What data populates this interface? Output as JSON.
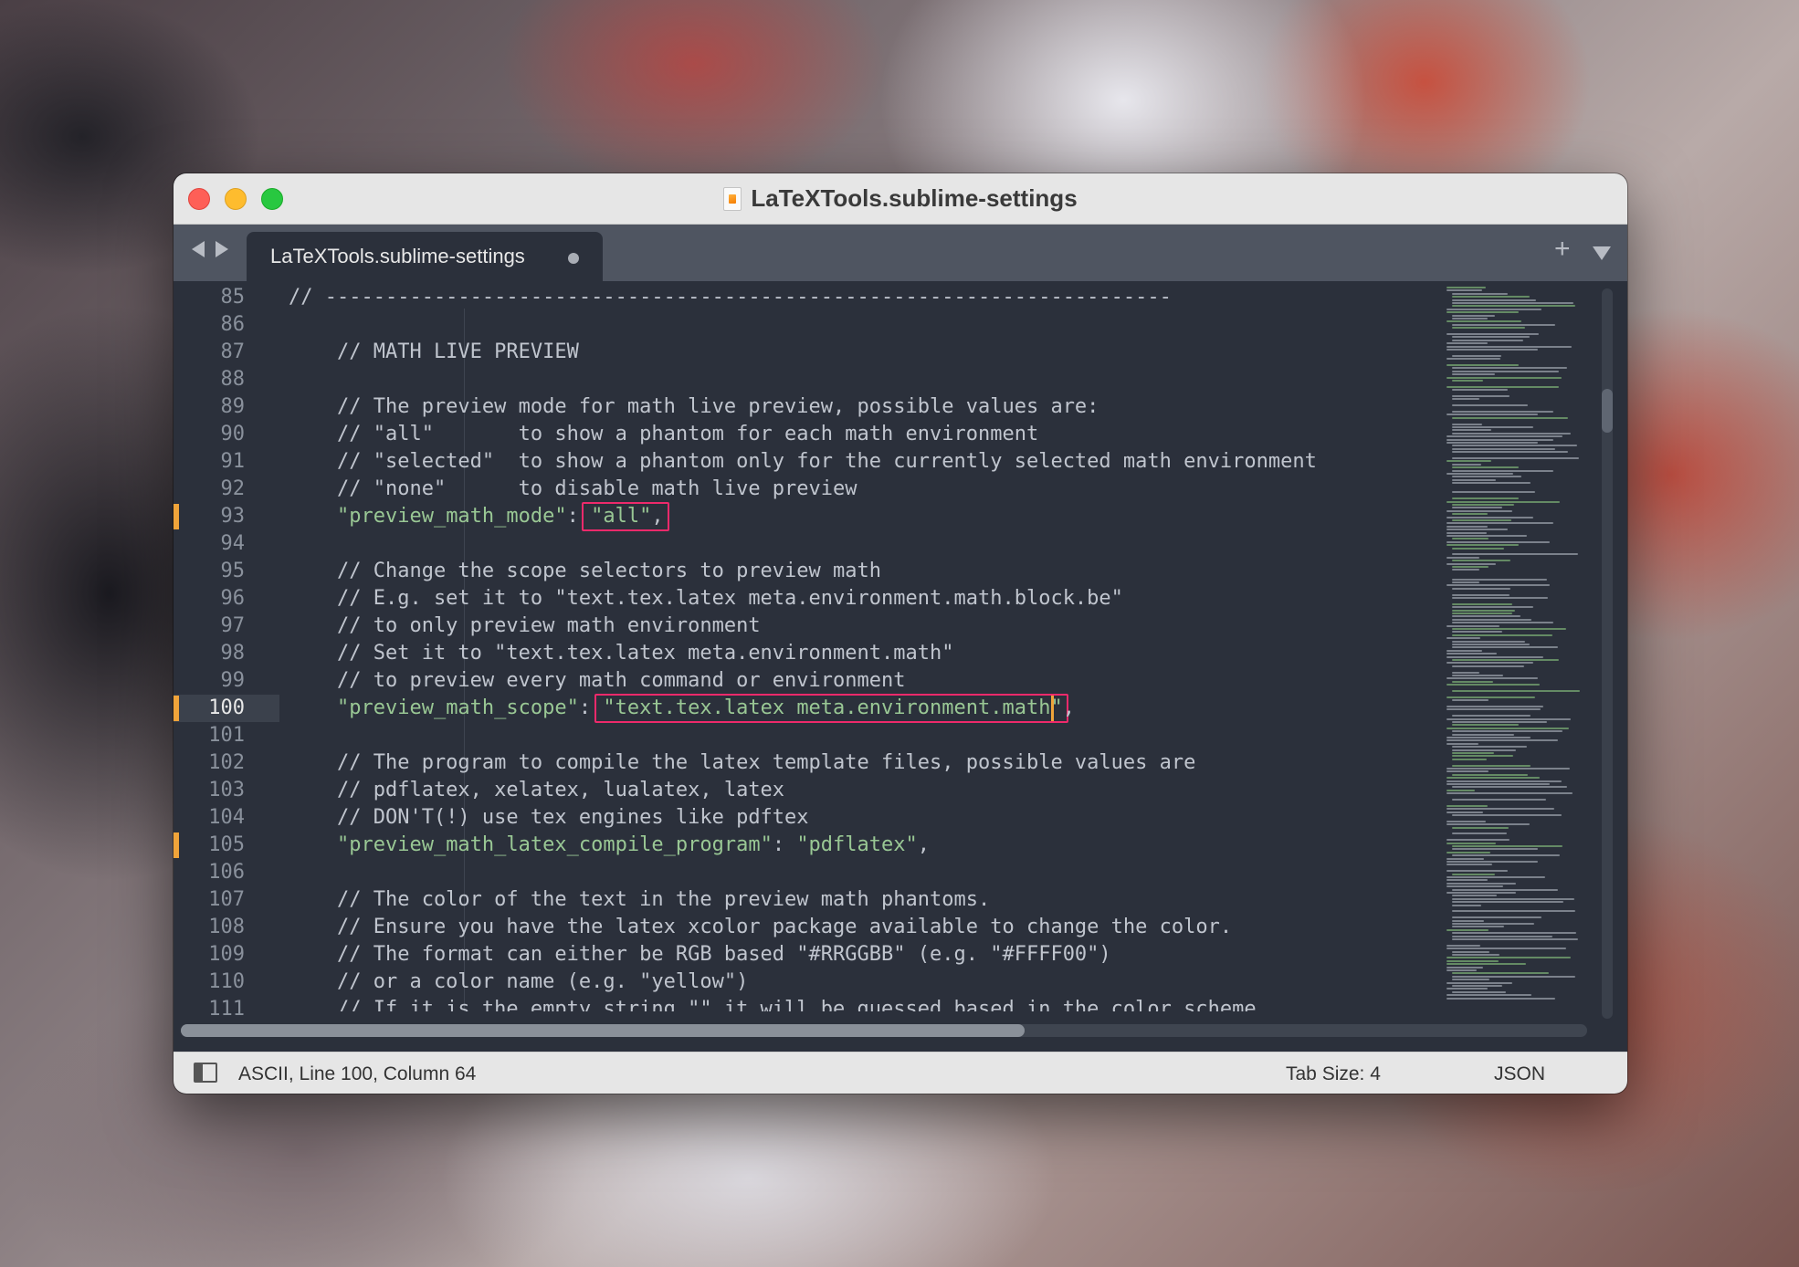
{
  "window": {
    "title": "LaTeXTools.sublime-settings"
  },
  "tabs": [
    {
      "label": "LaTeXTools.sublime-settings",
      "modified": true
    }
  ],
  "editor": {
    "current_line": 100,
    "lines": [
      {
        "n": "85",
        "text": "// ----------------------------------------------------------------------"
      },
      {
        "n": "86",
        "text": ""
      },
      {
        "n": "87",
        "text": "    // MATH LIVE PREVIEW"
      },
      {
        "n": "88",
        "text": ""
      },
      {
        "n": "89",
        "text": "    // The preview mode for math live preview, possible values are:"
      },
      {
        "n": "90",
        "text": "    // \"all\"       to show a phantom for each math environment"
      },
      {
        "n": "91",
        "text": "    // \"selected\"  to show a phantom only for the currently selected math environment"
      },
      {
        "n": "92",
        "text": "    // \"none\"      to disable math live preview"
      },
      {
        "n": "93",
        "key": "\"preview_math_mode\"",
        "sep": ": ",
        "value": "\"all\"",
        "tail": ","
      },
      {
        "n": "94",
        "text": ""
      },
      {
        "n": "95",
        "text": "    // Change the scope selectors to preview math"
      },
      {
        "n": "96",
        "text": "    // E.g. set it to \"text.tex.latex meta.environment.math.block.be\""
      },
      {
        "n": "97",
        "text": "    // to only preview math environment"
      },
      {
        "n": "98",
        "text": "    // Set it to \"text.tex.latex meta.environment.math\""
      },
      {
        "n": "99",
        "text": "    // to preview every math command or environment"
      },
      {
        "n": "100",
        "key": "\"preview_math_scope\"",
        "sep": ": ",
        "value": "\"text.tex.latex meta.environment.math\"",
        "tail": ","
      },
      {
        "n": "101",
        "text": ""
      },
      {
        "n": "102",
        "text": "    // The program to compile the latex template files, possible values are"
      },
      {
        "n": "103",
        "text": "    // pdflatex, xelatex, lualatex, latex"
      },
      {
        "n": "104",
        "text": "    // DON'T(!) use tex engines like pdftex"
      },
      {
        "n": "105",
        "key": "\"preview_math_latex_compile_program\"",
        "sep": ": ",
        "value": "\"pdflatex\"",
        "tail": ","
      },
      {
        "n": "106",
        "text": ""
      },
      {
        "n": "107",
        "text": "    // The color of the text in the preview math phantoms."
      },
      {
        "n": "108",
        "text": "    // Ensure you have the latex xcolor package available to change the color."
      },
      {
        "n": "109",
        "text": "    // The format can either be RGB based \"#RRGGBB\" (e.g. \"#FFFF00\")"
      },
      {
        "n": "110",
        "text": "    // or a color name (e.g. \"yellow\")"
      },
      {
        "n": "111",
        "text": "    // If it is the empty string \"\" it will be guessed based in the color scheme."
      }
    ]
  },
  "status_bar": {
    "position": "ASCII, Line 100, Column 64",
    "tab_size": "Tab Size: 4",
    "syntax": "JSON"
  },
  "colors": {
    "editor_bg": "#2b303b",
    "comment": "#c0c5ce",
    "string": "#99c794",
    "highlight_box": "#ee2a6b",
    "caret": "#f0a43a"
  }
}
